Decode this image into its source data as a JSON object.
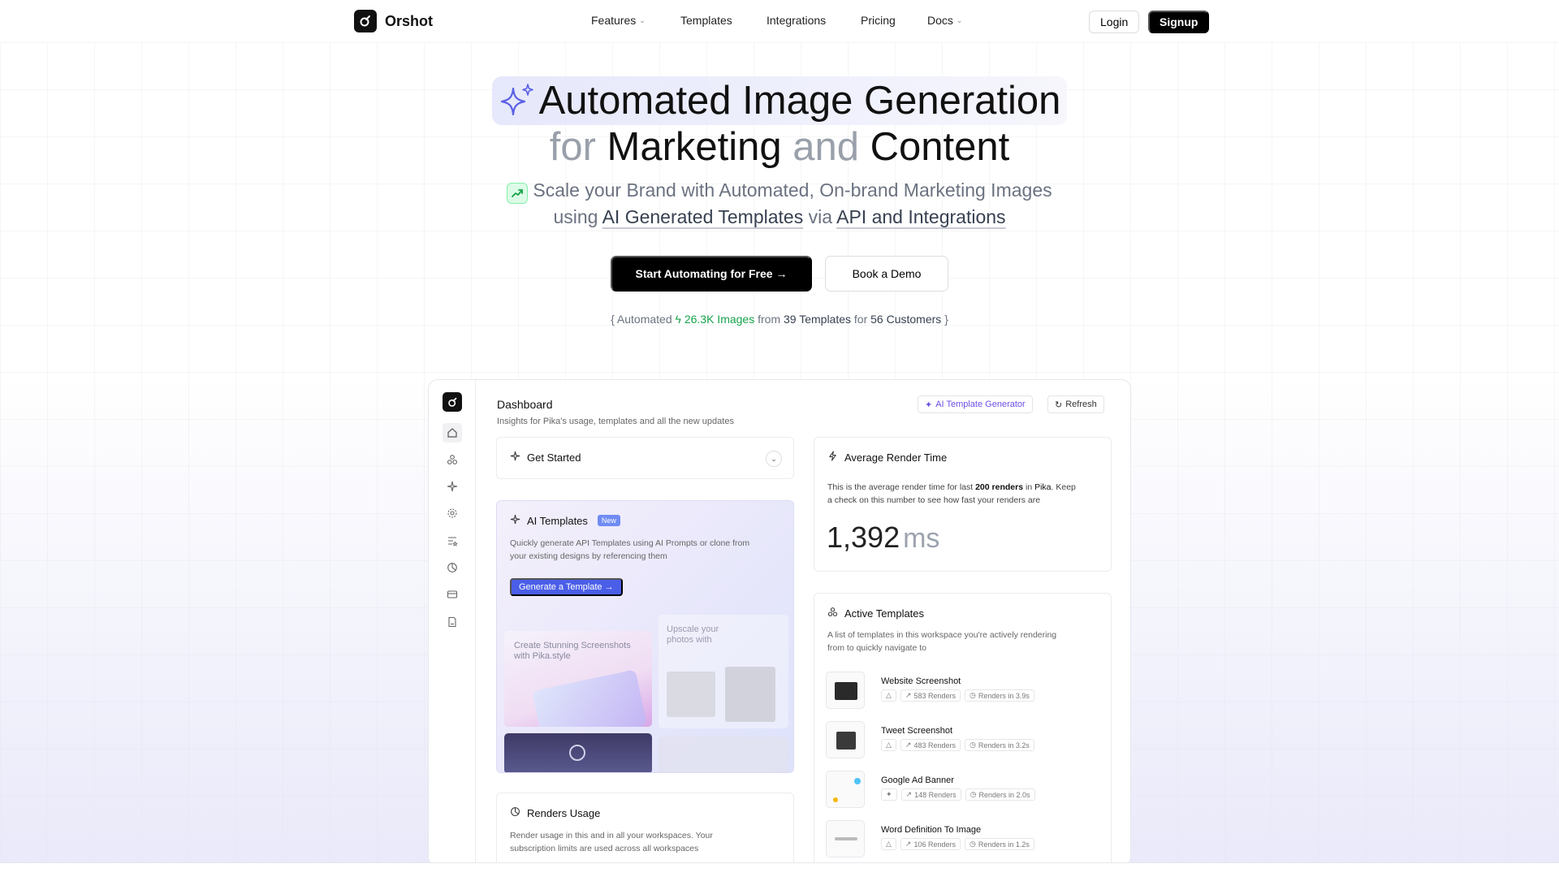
{
  "nav": {
    "brand": "Orshot",
    "links": [
      {
        "label": "Features",
        "dropdown": true
      },
      {
        "label": "Templates",
        "dropdown": false
      },
      {
        "label": "Integrations",
        "dropdown": false
      },
      {
        "label": "Pricing",
        "dropdown": false
      },
      {
        "label": "Docs",
        "dropdown": true
      }
    ],
    "login": "Login",
    "signup": "Signup"
  },
  "hero": {
    "line1": "Automated Image Generation",
    "line2": {
      "w1": "for",
      "w2": "Marketing",
      "w3": "and",
      "w4": "Content"
    },
    "sub1": "Scale your Brand with Automated, On-brand Marketing Images",
    "sub2": {
      "a": "using",
      "b": "AI Generated Templates",
      "c": "via",
      "d": "API and Integrations"
    },
    "cta_primary": "Start Automating for Free →",
    "cta_secondary": "Book a Demo",
    "stats": {
      "open": "{ Automated",
      "images": "26.3K Images",
      "from": "from",
      "templates": "39 Templates",
      "for": "for",
      "customers": "56 Customers",
      "close": "}"
    }
  },
  "dashboard": {
    "title": "Dashboard",
    "subtitle": "Insights for Pika's usage, templates and all the new updates",
    "ai_template_generator": "AI Template Generator",
    "refresh": "Refresh",
    "get_started": "Get Started",
    "ai_templates": {
      "title": "AI Templates",
      "badge": "New",
      "desc1": "Quickly generate API Templates using AI Prompts or clone from",
      "desc2": "your existing designs by referencing them",
      "button": "Generate a Template →",
      "thumb_a": "Create Stunning Screenshots with Pika.style",
      "thumb_b1": "Upscale your",
      "thumb_b2": "photos with"
    },
    "renders_usage": {
      "title": "Renders Usage",
      "desc1": "Render usage in this and in all your workspaces. Your",
      "desc2": "subscription limits are used across all workspaces"
    },
    "avg_render": {
      "title": "Average Render Time",
      "desc_a": "This is the average render time for last",
      "desc_b": "200 renders",
      "desc_c": "in",
      "desc_d": "Pika",
      "desc_e": ". Keep",
      "desc_line2": "a check on this number to see how fast your renders are",
      "value": "1,392",
      "unit": "ms"
    },
    "active_templates": {
      "title": "Active Templates",
      "desc1": "A list of templates in this workspace you're actively rendering",
      "desc2": "from to quickly navigate to",
      "items": [
        {
          "name": "Website Screenshot",
          "renders": "583 Renders",
          "time": "Renders in 3.9s"
        },
        {
          "name": "Tweet Screenshot",
          "renders": "483 Renders",
          "time": "Renders in 3.2s"
        },
        {
          "name": "Google Ad Banner",
          "renders": "148 Renders",
          "time": "Renders in 2.0s"
        },
        {
          "name": "Word Definition To Image",
          "renders": "106 Renders",
          "time": "Renders in 1.2s"
        }
      ]
    }
  },
  "colors": {
    "accent_purple": "#6d4ee6",
    "accent_blue": "#4a5ee8",
    "accent_green": "#16a34a"
  }
}
